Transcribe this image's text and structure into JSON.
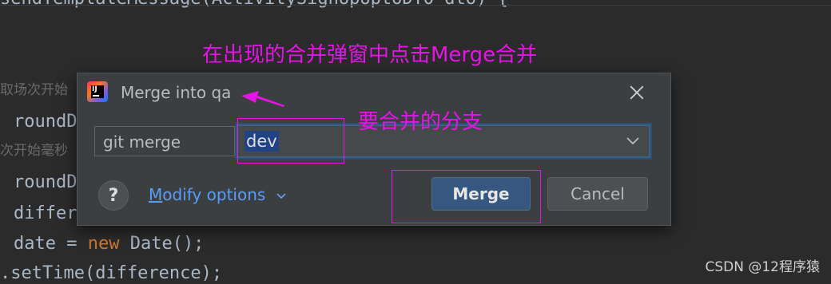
{
  "code": {
    "top_line": "sendTemplateMessage(ActivitySignUpUptoDTO dto) {",
    "lines": [
      {
        "text": "roundD",
        "kw": ""
      },
      {
        "text": "roundD",
        "kw": ""
      },
      {
        "text": "differ",
        "kw": ""
      },
      {
        "pre": "date = ",
        "kw": "new",
        "post": " Date();"
      },
      {
        "text": ".setTime(difference);",
        "kw": ""
      }
    ],
    "comments": [
      "取场次开始",
      "次开始毫秒"
    ]
  },
  "annotations": {
    "top": "在出现的合并弹窗中点击Merge合并",
    "branch": "要合并的分支"
  },
  "dialog": {
    "title": "Merge into qa",
    "command_label": "git merge",
    "branch_value": "dev",
    "help_label": "?",
    "modify_first": "M",
    "modify_rest": "odify options",
    "merge_label": "Merge",
    "cancel_label": "Cancel"
  },
  "watermark": "CSDN @12程序猿",
  "colors": {
    "accent": "#e614e6",
    "primary_button": "#365880",
    "link": "#589df6"
  }
}
